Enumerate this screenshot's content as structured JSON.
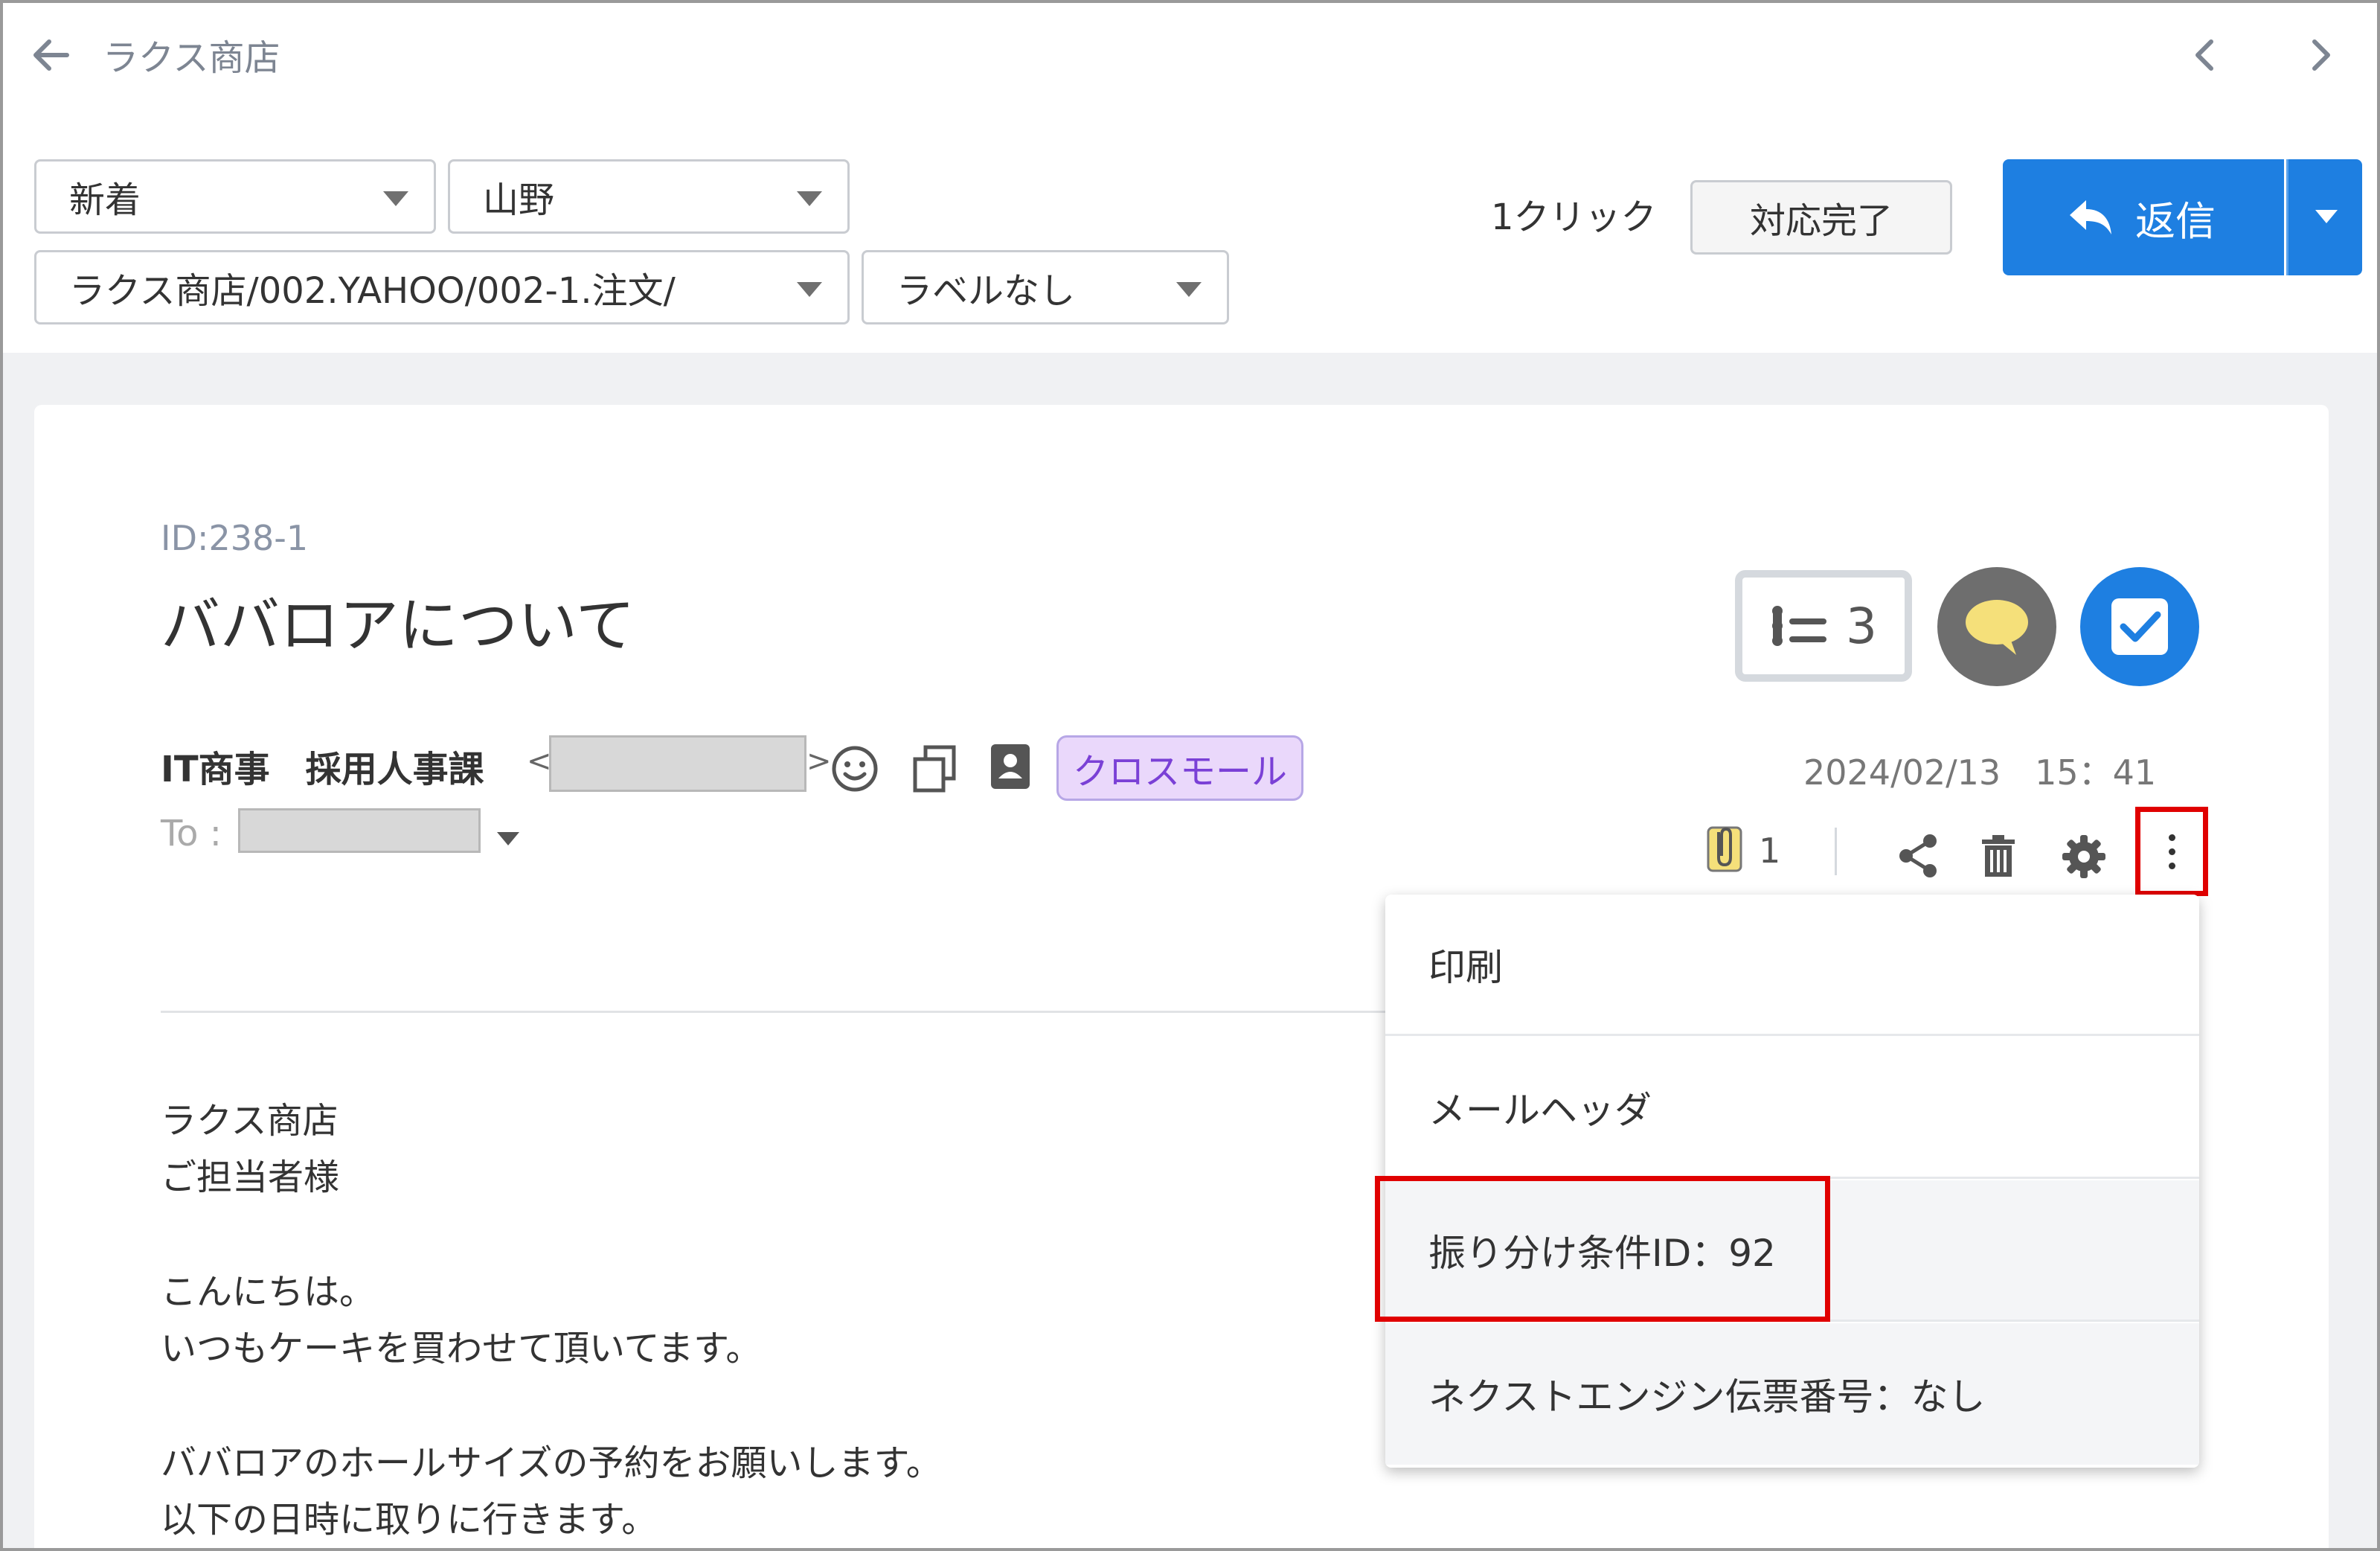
{
  "header": {
    "shop_title": "ラクス商店"
  },
  "filters": {
    "status": "新着",
    "user": "山野",
    "folder": "ラクス商店/002.YAHOO/002-1.注文/",
    "label": "ラベルなし"
  },
  "actions": {
    "oneclick_label": "1クリック",
    "done_label": "対応完了",
    "reply_label": "返信"
  },
  "mail": {
    "id": "ID:238-1",
    "subject": "ババロアについて",
    "task_count": "3",
    "sender_name": "IT商事　採用人事課",
    "shop_tag": "クロスモール",
    "date": "2024/02/13　15：41",
    "to_label": "To :",
    "attachment_count": "1",
    "body": [
      "ラクス商店",
      "ご担当者様",
      "こんにちは。",
      "いつもケーキを買わせて頂いてます。",
      "ババロアのホールサイズの予約をお願いします。",
      "以下の日時に取りに行きます。"
    ]
  },
  "menu": {
    "items": [
      "印刷",
      "メールヘッダ",
      "振り分け条件ID：92",
      "ネクストエンジン伝票番号：なし"
    ]
  },
  "colors": {
    "primary": "#1e7fe1",
    "highlight": "#e00000",
    "tag_bg": "#ead8fb",
    "tag_text": "#7a40d6"
  }
}
